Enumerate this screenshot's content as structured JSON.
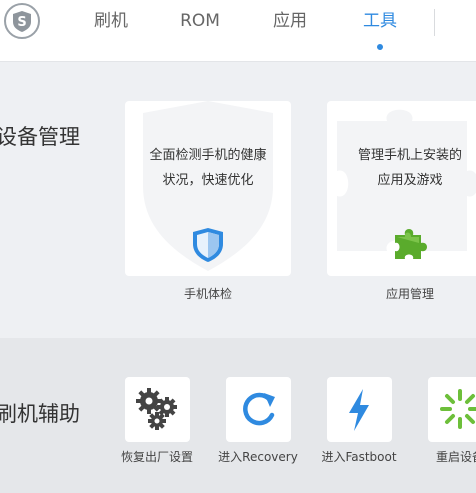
{
  "header": {
    "logo_icon": "shield-s-logo-icon",
    "tabs": [
      {
        "label": "刷机",
        "active": false
      },
      {
        "label": "ROM",
        "active": false
      },
      {
        "label": "应用",
        "active": false
      },
      {
        "label": "工具",
        "active": true
      }
    ],
    "accent_color": "#2f8ae0"
  },
  "device_management": {
    "title": "设备管理",
    "cards": [
      {
        "line1": "全面检测手机的健康",
        "line2": "状况，快速优化",
        "caption": "手机体检",
        "icon": "shield-icon"
      },
      {
        "line1": "管理手机上安装的",
        "line2": "应用及游戏",
        "caption": "应用管理",
        "icon": "puzzle-icon"
      }
    ]
  },
  "flash_assist": {
    "title": "刷机辅助",
    "tools": [
      {
        "label": "恢复出厂设置",
        "icon": "gears-icon"
      },
      {
        "label": "进入Recovery",
        "icon": "refresh-icon"
      },
      {
        "label": "进入Fastboot",
        "icon": "lightning-icon"
      },
      {
        "label": "重启设备",
        "icon": "loading-spinner-icon"
      }
    ]
  }
}
